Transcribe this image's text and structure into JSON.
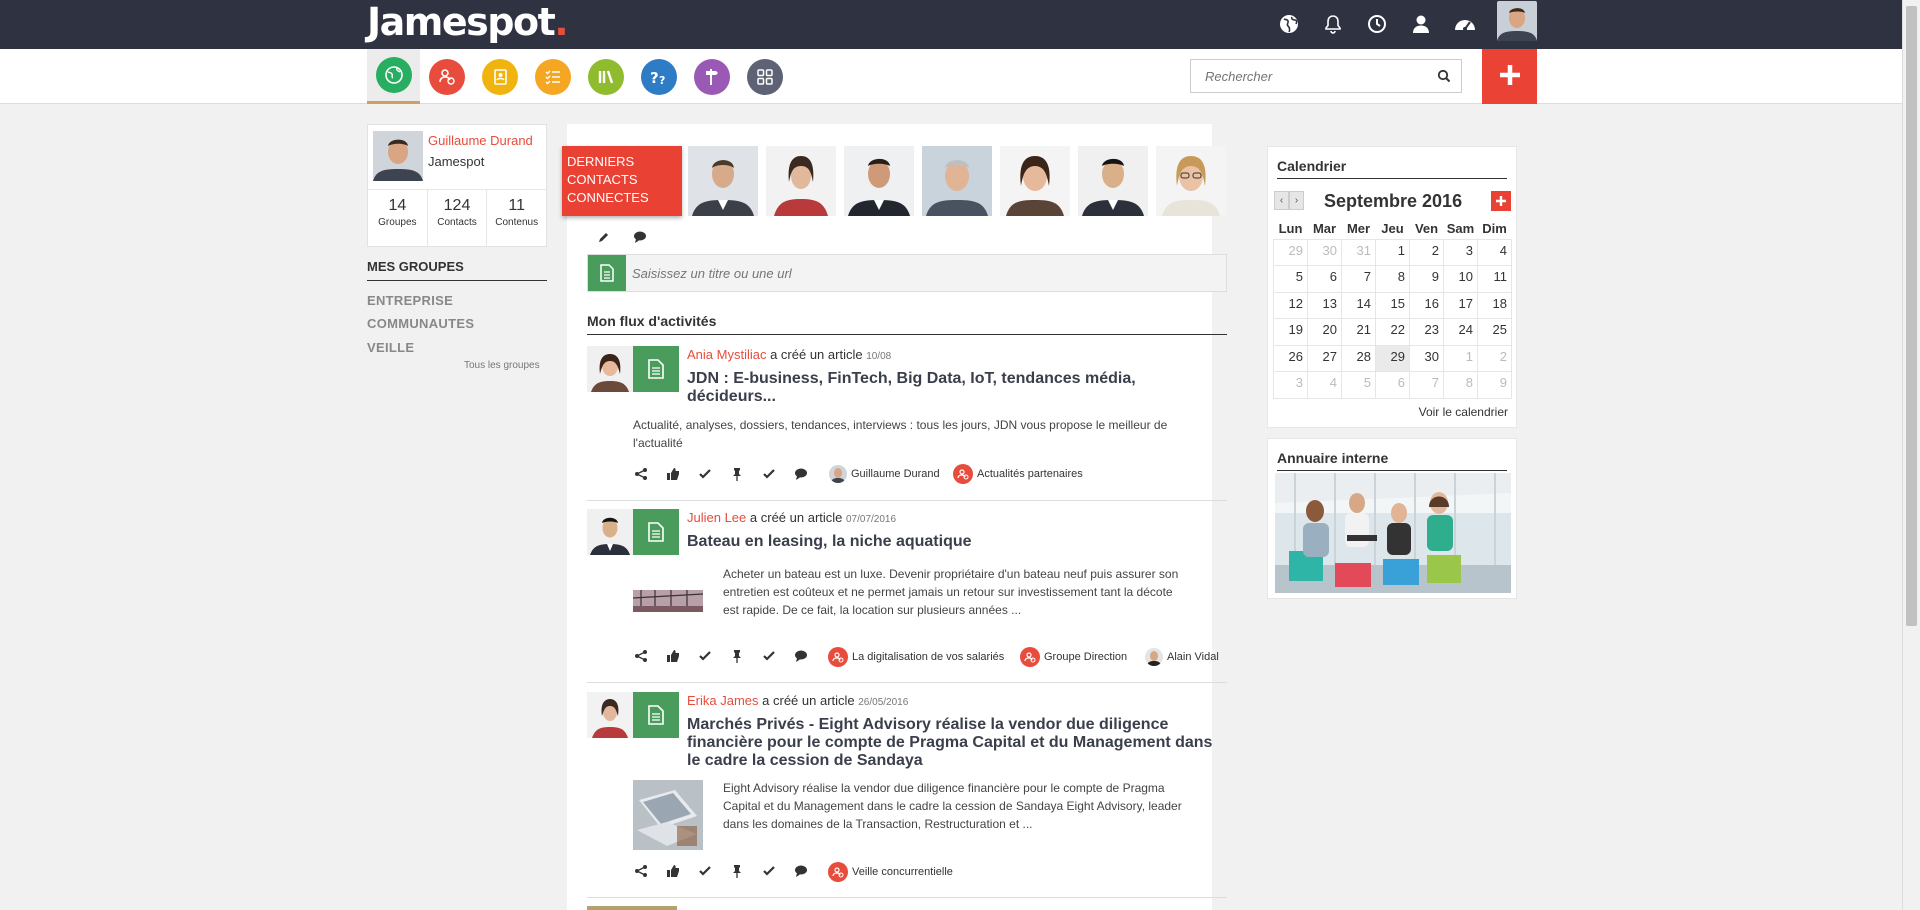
{
  "header": {
    "logo": "Jamespot",
    "logo_dot": ".",
    "icons": [
      "globe-icon",
      "bell-icon",
      "clock-icon",
      "user-icon",
      "dashboard-icon"
    ]
  },
  "nav": {
    "apps": [
      {
        "name": "globe-app-icon",
        "color": "#27ae60"
      },
      {
        "name": "people-app-icon",
        "color": "#e74c3c"
      },
      {
        "name": "contacts-app-icon",
        "color": "#f1b40f"
      },
      {
        "name": "tasks-app-icon",
        "color": "#f5a623"
      },
      {
        "name": "library-app-icon",
        "color": "#8fbc2f"
      },
      {
        "name": "help-app-icon",
        "color": "#2e7bc6"
      },
      {
        "name": "signpost-app-icon",
        "color": "#9b59b6"
      },
      {
        "name": "apps-grid-icon",
        "color": "#5d6374"
      }
    ],
    "search_placeholder": "Rechercher"
  },
  "profile": {
    "name": "Guillaume Durand",
    "org": "Jamespot",
    "stats": [
      {
        "num": "14",
        "label": "Groupes"
      },
      {
        "num": "124",
        "label": "Contacts"
      },
      {
        "num": "11",
        "label": "Contenus"
      }
    ]
  },
  "groups": {
    "title": "MES GROUPES",
    "items": [
      "ENTREPRISE",
      "COMMUNAUTES",
      "VEILLE"
    ],
    "all_link": "Tous les groupes"
  },
  "contacts": {
    "label_line1": "DERNIERS",
    "label_line2": "CONTACTS",
    "label_line3": "CONNECTES"
  },
  "composer": {
    "placeholder": "Saisissez un titre ou une url"
  },
  "feed": {
    "title": "Mon flux d'activités",
    "posts": [
      {
        "author": "Ania Mystiliac",
        "action": " a créé un article ",
        "date": "10/08",
        "title_line1": "JDN : E-business, FinTech, Big Data, IoT, tendances média,",
        "title_line2": "décideurs...",
        "text_line1": "Actualité, analyses, dossiers, tendances, interviews : tous les jours, JDN vous propose le meilleur de",
        "text_line2": "l'actualité",
        "tags": [
          "Guillaume Durand",
          "Actualités partenaires"
        ]
      },
      {
        "author": "Julien Lee",
        "action": " a créé un article ",
        "date": "07/07/2016",
        "title_line1": "Bateau en leasing, la niche aquatique",
        "text_line1": "Acheter un bateau est un luxe. Devenir propriétaire d'un bateau neuf puis assurer son",
        "text_line2": "entretien est coûteux et ne permet jamais un retour sur investissement tant la décote",
        "text_line3": "est rapide. De ce fait, la location sur plusieurs années ...",
        "tags": [
          "La digitalisation de vos salariés",
          "Groupe Direction",
          "Alain Vidal"
        ]
      },
      {
        "author": "Erika James",
        "action": " a créé un article ",
        "date": "26/05/2016",
        "title_line1": "Marchés Privés - Eight Advisory réalise la vendor due diligence",
        "title_line2": "financière pour le compte de Pragma Capital et du Management dans",
        "title_line3": "le cadre la cession de Sandaya",
        "text_line1": "Eight Advisory réalise la vendor due diligence financière pour le compte de Pragma",
        "text_line2": "Capital et du Management dans le cadre la cession de Sandaya Eight Advisory, leader",
        "text_line3": "dans les domaines de la Transaction, Restructuration et ...",
        "tags": [
          "Veille concurrentielle"
        ]
      }
    ]
  },
  "calendar": {
    "title": "Calendrier",
    "prev": "‹",
    "next": "›",
    "month": "Septembre 2016",
    "days": [
      "Lun",
      "Mar",
      "Mer",
      "Jeu",
      "Ven",
      "Sam",
      "Dim"
    ],
    "weeks": [
      [
        "29",
        "30",
        "31",
        "1",
        "2",
        "3",
        "4"
      ],
      [
        "5",
        "6",
        "7",
        "8",
        "9",
        "10",
        "11"
      ],
      [
        "12",
        "13",
        "14",
        "15",
        "16",
        "17",
        "18"
      ],
      [
        "19",
        "20",
        "21",
        "22",
        "23",
        "24",
        "25"
      ],
      [
        "26",
        "27",
        "28",
        "29",
        "30",
        "1",
        "2"
      ],
      [
        "3",
        "4",
        "5",
        "6",
        "7",
        "8",
        "9"
      ]
    ],
    "link": "Voir le calendrier"
  },
  "directory": {
    "title": "Annuaire interne"
  },
  "colors": {
    "topbar": "#2e3241",
    "accent_red": "#e94235",
    "article_green": "#4a9c5d"
  }
}
